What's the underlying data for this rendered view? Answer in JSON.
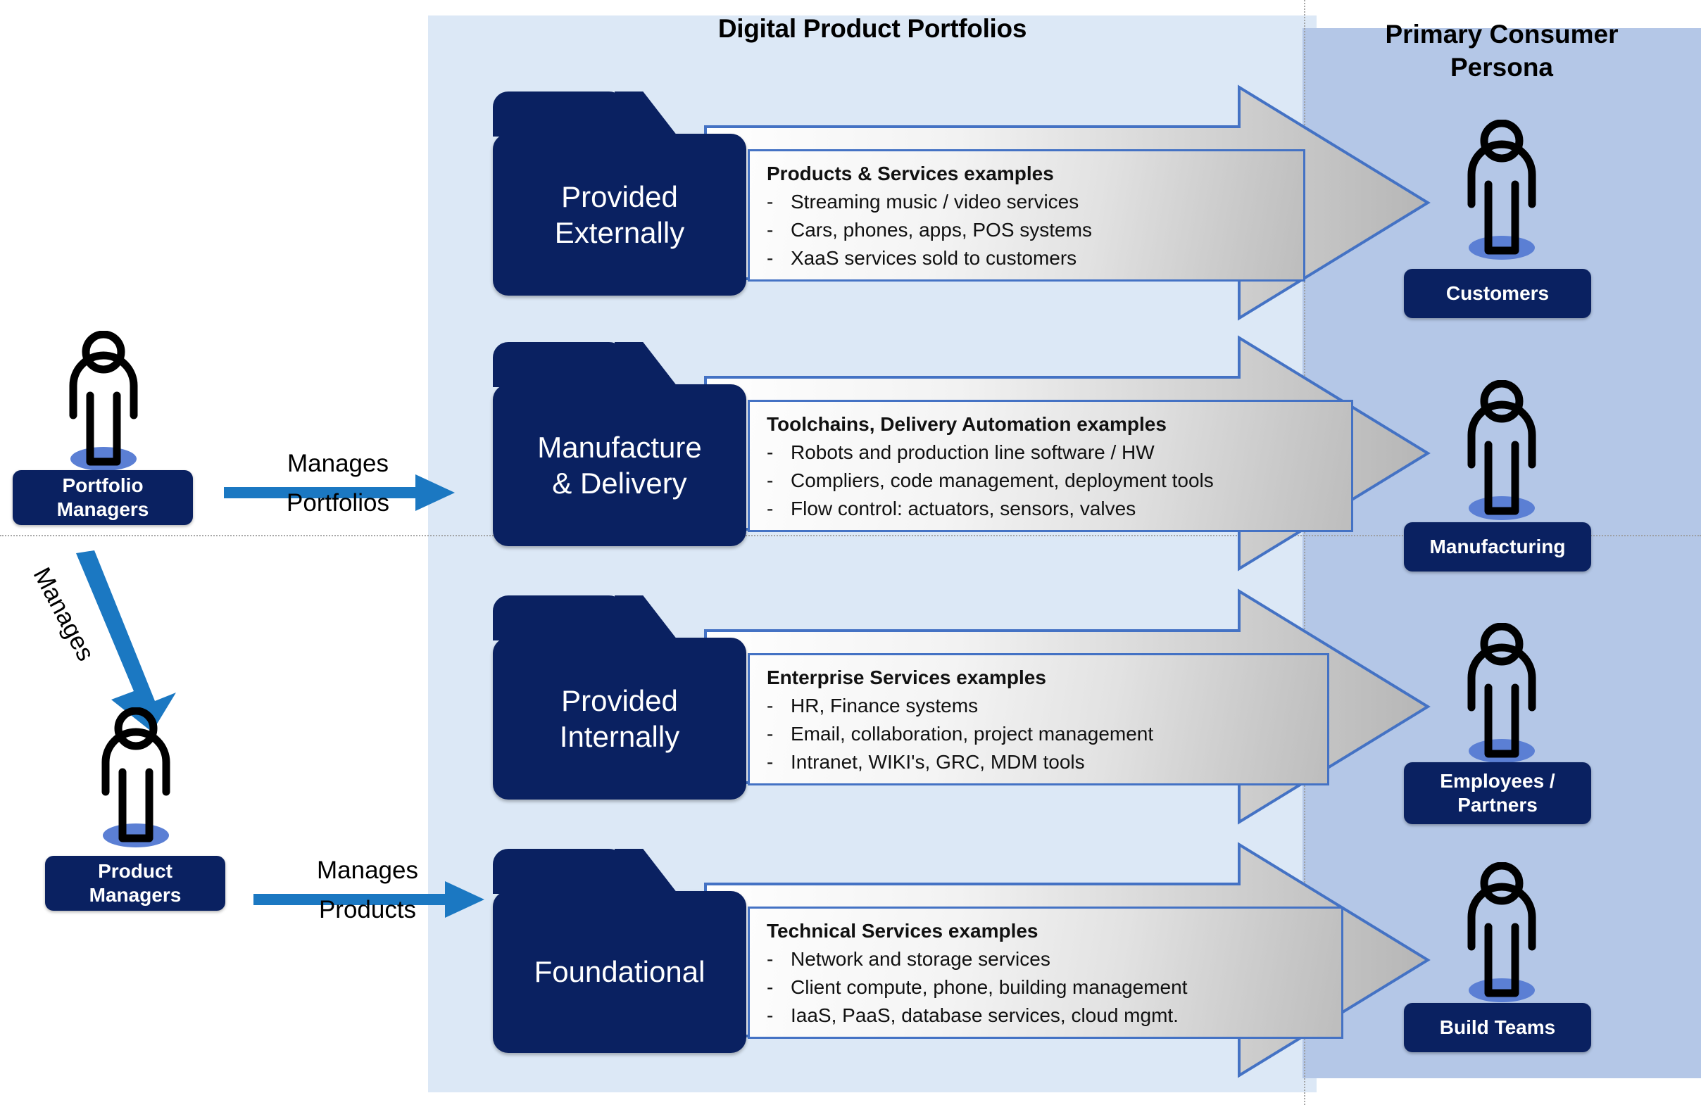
{
  "headings": {
    "portfolios": "Digital Product Portfolios",
    "persona_line1": "Primary Consumer",
    "persona_line2": "Persona"
  },
  "colors": {
    "navy": "#0a2161",
    "panel_portfolios": "#dce8f6",
    "panel_persona": "#b4c7e7",
    "arrow_border": "#4472c4",
    "manage_arrow": "#1b78c2",
    "person_shadow": "#5b7fd4"
  },
  "managers": [
    {
      "icon": "person-icon",
      "pill_line1": "Portfolio",
      "pill_line2": "Managers",
      "arrow_label_line1": "Manages",
      "arrow_label_line2": "Portfolios"
    },
    {
      "icon": "person-icon",
      "pill_line1": "Product",
      "pill_line2": "Managers",
      "arrow_label_line1": "Manages",
      "arrow_label_line2": "Products"
    }
  ],
  "diagonal_arrow": {
    "icon": "arrow-down-right-icon",
    "label": "Manages"
  },
  "rows": [
    {
      "folder_line1": "Provided",
      "folder_line2": "Externally",
      "examples_title": "Products & Services examples",
      "bullets": [
        "Streaming music / video services",
        "Cars, phones, apps, POS systems",
        "XaaS services sold to customers"
      ]
    },
    {
      "folder_line1": "Manufacture",
      "folder_line2": "& Delivery",
      "examples_title": "Toolchains, Delivery Automation examples",
      "bullets": [
        "Robots and production line software / HW",
        "Compliers, code management, deployment tools",
        "Flow control: actuators, sensors, valves"
      ]
    },
    {
      "folder_line1": "Provided",
      "folder_line2": "Internally",
      "examples_title": "Enterprise Services examples",
      "bullets": [
        "HR, Finance systems",
        "Email, collaboration, project management",
        "Intranet, WIKI's, GRC, MDM tools"
      ]
    },
    {
      "folder_line1": "Foundational",
      "folder_line2": "",
      "examples_title": "Technical Services examples",
      "bullets": [
        "Network and storage services",
        "Client compute, phone, building management",
        "IaaS, PaaS, database services, cloud mgmt."
      ]
    }
  ],
  "personas": [
    {
      "icon": "person-icon",
      "label_line1": "Customers",
      "label_line2": ""
    },
    {
      "icon": "person-icon",
      "label_line1": "Manufacturing",
      "label_line2": ""
    },
    {
      "icon": "person-icon",
      "label_line1": "Employees /",
      "label_line2": "Partners"
    },
    {
      "icon": "person-icon",
      "label_line1": "Build Teams",
      "label_line2": ""
    }
  ],
  "bullet_marker": "-"
}
